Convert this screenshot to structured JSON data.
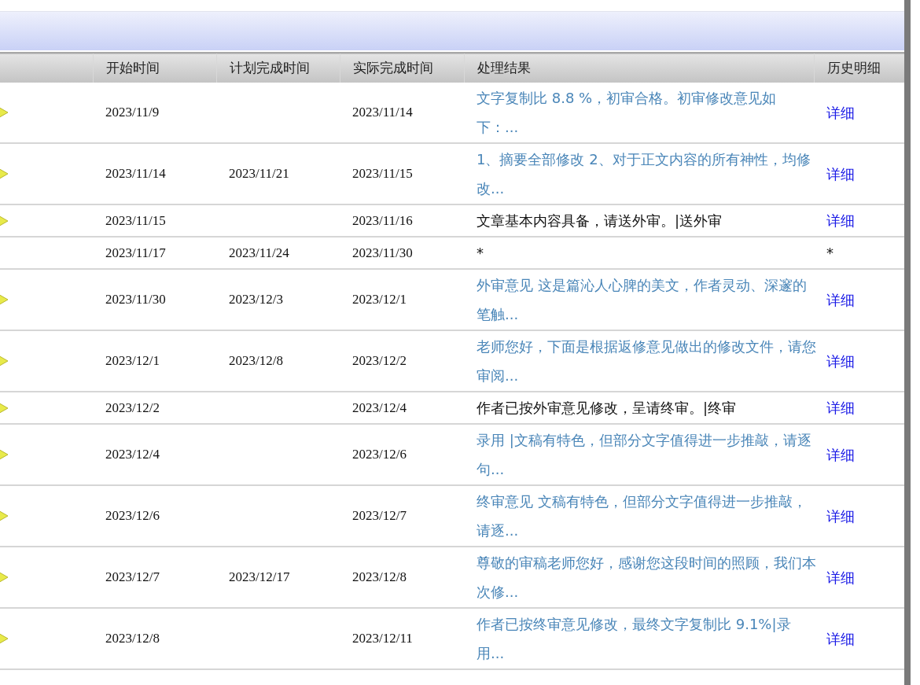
{
  "table": {
    "columns": [
      "开始时间",
      "计划完成时间",
      "实际完成时间",
      "处理结果",
      "历史明细"
    ],
    "rows": [
      {
        "marker": true,
        "start": "2023/11/9",
        "planned": "",
        "actual": "2023/11/14",
        "result": {
          "text": "文字复制比 8.8 %，初审合格。初审修改意见如下：...",
          "kind": "link"
        },
        "history": {
          "text": "详细",
          "kind": "link"
        }
      },
      {
        "marker": true,
        "start": "2023/11/14",
        "planned": "2023/11/21",
        "actual": "2023/11/15",
        "result": {
          "text": "1、摘要全部修改 2、对于正文内容的所有神性，均修改...",
          "kind": "link"
        },
        "history": {
          "text": "详细",
          "kind": "link"
        }
      },
      {
        "marker": true,
        "start": "2023/11/15",
        "planned": "",
        "actual": "2023/11/16",
        "result": {
          "text": "文章基本内容具备，请送外审。|送外审",
          "kind": "plain"
        },
        "history": {
          "text": "详细",
          "kind": "link"
        }
      },
      {
        "marker": false,
        "start": "2023/11/17",
        "planned": "2023/11/24",
        "actual": "2023/11/30",
        "result": {
          "text": "*",
          "kind": "plain"
        },
        "history": {
          "text": "*",
          "kind": "plain"
        }
      },
      {
        "marker": true,
        "start": "2023/11/30",
        "planned": "2023/12/3",
        "actual": "2023/12/1",
        "result": {
          "text": "外审意见 这是篇沁人心脾的美文，作者灵动、深邃的笔触...",
          "kind": "link"
        },
        "history": {
          "text": "详细",
          "kind": "link"
        }
      },
      {
        "marker": true,
        "start": "2023/12/1",
        "planned": "2023/12/8",
        "actual": "2023/12/2",
        "result": {
          "text": "老师您好，下面是根据返修意见做出的修改文件，请您审阅...",
          "kind": "link"
        },
        "history": {
          "text": "详细",
          "kind": "link"
        }
      },
      {
        "marker": true,
        "start": "2023/12/2",
        "planned": "",
        "actual": "2023/12/4",
        "result": {
          "text": "作者已按外审意见修改，呈请终审。|终审",
          "kind": "plain"
        },
        "history": {
          "text": "详细",
          "kind": "link"
        }
      },
      {
        "marker": true,
        "start": "2023/12/4",
        "planned": "",
        "actual": "2023/12/6",
        "result": {
          "text": "录用 |文稿有特色，但部分文字值得进一步推敲，请逐句...",
          "kind": "link"
        },
        "history": {
          "text": "详细",
          "kind": "link"
        }
      },
      {
        "marker": true,
        "start": "2023/12/6",
        "planned": "",
        "actual": "2023/12/7",
        "result": {
          "text": "终审意见 文稿有特色，但部分文字值得进一步推敲，请逐...",
          "kind": "link"
        },
        "history": {
          "text": "详细",
          "kind": "link"
        }
      },
      {
        "marker": true,
        "start": "2023/12/7",
        "planned": "2023/12/17",
        "actual": "2023/12/8",
        "result": {
          "text": "尊敬的审稿老师您好，感谢您这段时间的照顾，我们本次修...",
          "kind": "link"
        },
        "history": {
          "text": "详细",
          "kind": "link"
        }
      },
      {
        "marker": true,
        "start": "2023/12/8",
        "planned": "",
        "actual": "2023/12/11",
        "result": {
          "text": "作者已按终审意见修改，最终文字复制比 9.1%|录用...",
          "kind": "link"
        },
        "history": {
          "text": "详细",
          "kind": "link"
        }
      }
    ]
  }
}
